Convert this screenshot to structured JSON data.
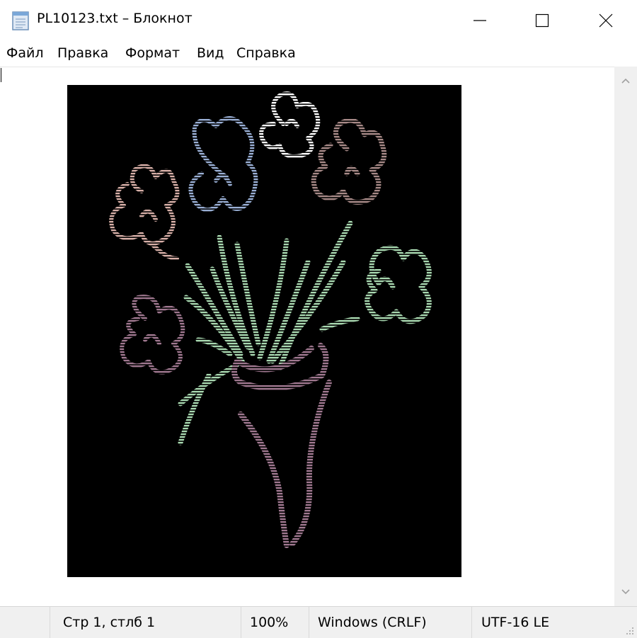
{
  "window": {
    "title": "PL10123.txt – Блокнот",
    "icon": "notepad-icon",
    "controls": {
      "minimize": "minimize-icon",
      "maximize": "maximize-icon",
      "close": "close-icon"
    }
  },
  "menu": {
    "items": [
      {
        "label": "Файл"
      },
      {
        "label": "Правка"
      },
      {
        "label": "Формат"
      },
      {
        "label": "Вид"
      },
      {
        "label": "Справка"
      }
    ]
  },
  "editor": {
    "content": "ascii-art-flowers-in-vase",
    "background": "#000000",
    "colors": {
      "blue_flower": "#9ab0d6",
      "white_flower": "#ffffff",
      "mauve_flower": "#a88a88",
      "pink_flower": "#d8b0a8",
      "green": "#a8d8b0",
      "purple": "#a07890"
    }
  },
  "status": {
    "position": "Стр 1, стлб 1",
    "zoom": "100%",
    "line_endings": "Windows (CRLF)",
    "encoding": "UTF-16 LE"
  }
}
